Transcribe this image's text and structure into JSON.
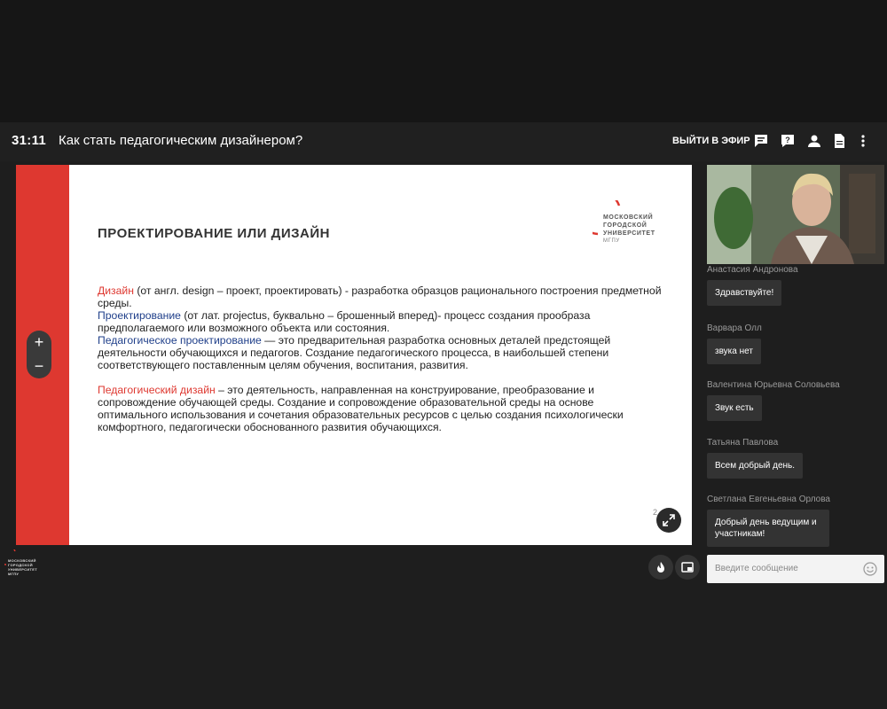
{
  "header": {
    "timer": "31:11",
    "title": "Как стать педагогическим дизайнером?",
    "leave_label": "ВЫЙТИ В ЭФИР",
    "icons": [
      "chat-icon",
      "help-icon",
      "person-icon",
      "document-icon",
      "more-vertical-icon"
    ]
  },
  "slide": {
    "title": "ПРОЕКТИРОВАНИЕ ИЛИ ДИЗАЙН",
    "logo_lines": [
      "МОСКОВСКИЙ",
      "ГОРОДСКОЙ",
      "УНИВЕРСИТЕТ"
    ],
    "logo_sub": "МГПУ",
    "p1_term": "Дизайн",
    "p1_text": " (от англ. design – проект, проектировать) - разработка образцов рационального построения предметной среды.",
    "p2_term": "Проектирование",
    "p2_text": " (от лат. projectus, буквально – брошенный вперед)- процесс создания прообраза предполагаемого или возможного объекта или состояния.",
    "p3_term": "Педагогическое проектирование",
    "p3_text": " — это предварительная разработка основных деталей предстоящей деятельности обучающихся и педагогов. Создание педагогического процесса, в наибольшей степени соответствующего поставленным целям обучения, воспитания, развития.",
    "p4_term": "Педагогический дизайн",
    "p4_text": " – это деятельность, направленная на  конструирование, преобразование и сопровождение обучающей среды. Создание и сопровождение образовательной среды на основе оптимального использования и  сочетания образовательных ресурсов с целью создания психологически комфортного, педагогически обоснованного развития обучающихся.",
    "page_number": "2"
  },
  "zoom": {
    "plus": "+",
    "minus": "−"
  },
  "chat": {
    "messages": [
      {
        "author": "Анастасия Андронова",
        "text": "Здравствуйте!"
      },
      {
        "author": "Варвара Олл",
        "text": "звука нет"
      },
      {
        "author": "Валентина Юрьевна Соловьева",
        "text": "Звук есть"
      },
      {
        "author": "Татьяна Павлова",
        "text": "Всем добрый день."
      },
      {
        "author": "Светлана Евгеньевна Орлова",
        "text": "Добрый день ведущим и участникам!"
      }
    ],
    "input_placeholder": "Введите сообщение"
  },
  "bottom_logo_lines": [
    "МОСКОВСКИЙ",
    "ГОРОДСКОЙ",
    "УНИВЕРСИТЕТ",
    "МГПУ"
  ],
  "colors": {
    "accent_red": "#de3830",
    "term_blue": "#1f3f8a",
    "background": "#161616"
  }
}
